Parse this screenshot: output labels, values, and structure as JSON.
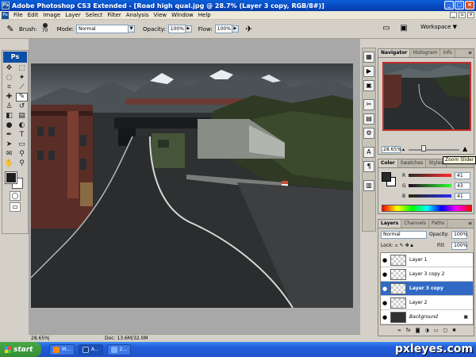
{
  "window": {
    "title": "Adobe Photoshop CS3 Extended - [Road high qual.jpg @ 28.7% (Layer 3 copy, RGB/8#)]"
  },
  "menu": {
    "app_icon": "Ps",
    "items": [
      "File",
      "Edit",
      "Image",
      "Layer",
      "Select",
      "Filter",
      "Analysis",
      "View",
      "Window",
      "Help"
    ]
  },
  "options": {
    "brush_label": "Brush:",
    "brush_size": "70",
    "mode_label": "Mode:",
    "mode_value": "Normal",
    "opacity_label": "Opacity:",
    "opacity_value": "100%",
    "flow_label": "Flow:",
    "flow_value": "100%",
    "workspace_label": "Workspace"
  },
  "toolbox": {
    "logo": "Ps"
  },
  "status": {
    "zoom": "28.65%",
    "doc": "Doc: 13.6M/32.0M"
  },
  "navigator": {
    "tabs": [
      "Navigator",
      "Histogram",
      "Info"
    ],
    "zoom_value": "28.65%",
    "zoom_level": 0.3,
    "tooltip": "Zoom Slider"
  },
  "color": {
    "tabs": [
      "Color",
      "Swatches",
      "Styles"
    ],
    "r_label": "R",
    "r_value": "41",
    "g_label": "G",
    "g_value": "43",
    "b_label": "B",
    "b_value": "41",
    "fg_color": "#292b29"
  },
  "layers": {
    "tabs": [
      "Layers",
      "Channels",
      "Paths"
    ],
    "blend_mode": "Normal",
    "opacity_label": "Opacity:",
    "opacity_value": "100%",
    "lock_label": "Lock:",
    "fill_label": "Fill:",
    "fill_value": "100%",
    "items": [
      {
        "name": "Layer 1"
      },
      {
        "name": "Layer 3 copy 2"
      },
      {
        "name": "Layer 3 copy",
        "selected": true
      },
      {
        "name": "Layer 2"
      },
      {
        "name": "Background",
        "locked": true
      }
    ]
  },
  "taskbar": {
    "start_label": "start",
    "tasks": [
      "M...",
      "A...",
      "2..."
    ]
  },
  "watermark": "pxleyes.com"
}
